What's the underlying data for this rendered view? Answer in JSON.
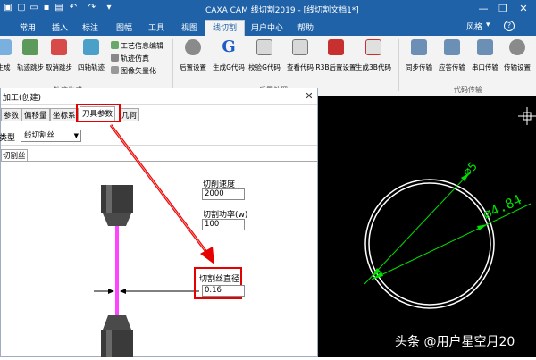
{
  "titlebar": {
    "title": "CAXA CAM 线切割2019 - [线切割文档1*]",
    "window_buttons": [
      "—",
      "❐",
      "✕"
    ]
  },
  "menubar": {
    "items": [
      {
        "label": "常用",
        "active": false
      },
      {
        "label": "插入",
        "active": false
      },
      {
        "label": "标注",
        "active": false
      },
      {
        "label": "图幅",
        "active": false
      },
      {
        "label": "工具",
        "active": false
      },
      {
        "label": "视图",
        "active": false
      },
      {
        "label": "线切割",
        "active": true
      },
      {
        "label": "用户中心",
        "active": false
      },
      {
        "label": "帮助",
        "active": false
      }
    ],
    "style_label": "风格",
    "style_caret": "▾",
    "help_icon_text": "?"
  },
  "ribbon": {
    "group1": {
      "buttons": [
        "生成",
        "轨迹跳步",
        "取消跳步",
        "四轴轨迹"
      ],
      "small_buttons": [
        "工艺信息编辑",
        "轨迹仿真",
        "图像矢量化"
      ],
      "group_label": "轨迹生成"
    },
    "group2": {
      "buttons": [
        "后置设置",
        "生成G代码",
        "校验G代码",
        "查看代码",
        "R3B后置设置",
        "生成3B代码"
      ],
      "group_label": "后置处理"
    },
    "group3": {
      "buttons": [
        "同步传输",
        "应答传输",
        "串口传输",
        "传输设置"
      ],
      "group_label": "代码传输"
    }
  },
  "dialog": {
    "title": "加工(创建)",
    "close": "✕",
    "tabs": [
      "参数",
      "偏移量",
      "坐标系",
      "刀具参数",
      "几何"
    ],
    "active_tab": "刀具参数",
    "type_label": "类型",
    "type_value": "线切割丝",
    "subtab": "切割丝",
    "cut_speed_label": "切削速度",
    "cut_speed_value": "2000",
    "cut_power_label": "切割功率(w)",
    "cut_power_value": "100",
    "wire_diameter_label": "切割丝直径",
    "wire_diameter_value": "0.16"
  },
  "cad": {
    "dim1": "∅5",
    "dim2": "∅4.84"
  },
  "watermark": "头条 @用户星空月20",
  "colors": {
    "title_blue": "#1f62a8",
    "highlight_red": "#e60000",
    "wire_magenta": "#ff44ff",
    "dim_green": "#00e000"
  }
}
